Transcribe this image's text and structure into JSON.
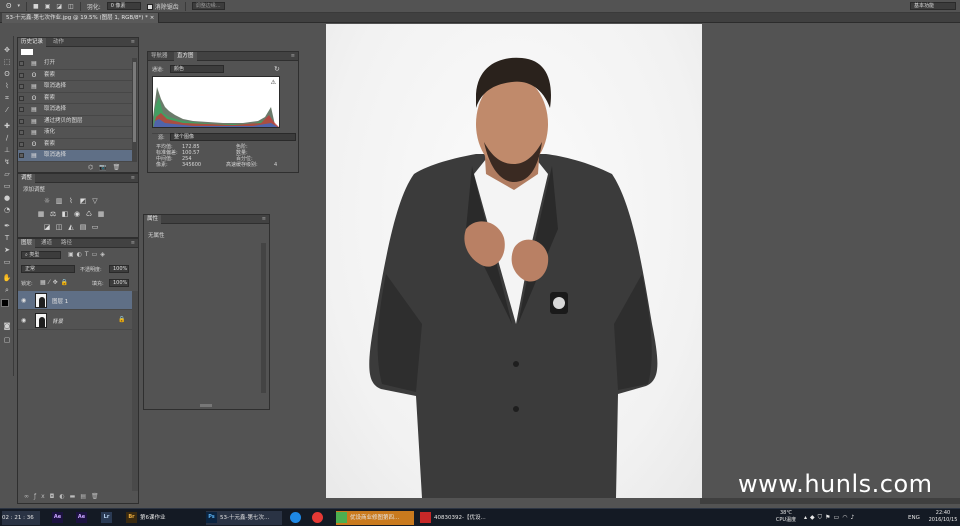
{
  "options_bar": {
    "feather_label": "羽化:",
    "feather_value": "0 像素",
    "antialias_label": "消除锯齿",
    "refine_edge": "调整边缘...",
    "workspace": "基本功能"
  },
  "document_tab": "53-十元鑫-第七次作业.jpg @ 19.5% (图层 1, RGB/8*) *",
  "history_panel": {
    "tabs": [
      "历史记录",
      "动作"
    ],
    "items": [
      {
        "icon": "document-icon",
        "label": "打开"
      },
      {
        "icon": "lasso-icon",
        "label": "套索"
      },
      {
        "icon": "document-icon",
        "label": "取消选择"
      },
      {
        "icon": "lasso-icon",
        "label": "套索"
      },
      {
        "icon": "document-icon",
        "label": "取消选择"
      },
      {
        "icon": "document-icon",
        "label": "通过拷贝的图层"
      },
      {
        "icon": "document-icon",
        "label": "液化"
      },
      {
        "icon": "lasso-icon",
        "label": "套索"
      },
      {
        "icon": "document-icon",
        "label": "取消选择"
      }
    ]
  },
  "adjustments_panel": {
    "tab": "调整",
    "title": "添加调整"
  },
  "layers_panel": {
    "tabs": [
      "图层",
      "通道",
      "路径"
    ],
    "filter": "类型",
    "blend_mode": "正常",
    "opacity_label": "不透明度:",
    "opacity_value": "100%",
    "lock_label": "锁定:",
    "fill_label": "填充:",
    "fill_value": "100%",
    "layers": [
      {
        "name": "图层 1",
        "selected": true
      },
      {
        "name": "背景",
        "selected": false,
        "locked": true
      }
    ]
  },
  "histogram_panel": {
    "tabs": [
      "导航器",
      "直方图"
    ],
    "channel_label": "通道:",
    "channel_value": "颜色",
    "source_label": "源:",
    "source_value": "整个图像",
    "stats": {
      "mean_label": "平均值:",
      "mean": "172.85",
      "stddev_label": "标准偏差:",
      "stddev": "100.57",
      "median_label": "中间值:",
      "median": "254",
      "pixels_label": "像素:",
      "pixels": "345600",
      "level_label": "色阶:",
      "count_label": "数量:",
      "percentile_label": "百分位:",
      "cache_label": "高速缓存级别:",
      "cache": "4"
    }
  },
  "properties_panel": {
    "tab": "属性",
    "content": "无属性"
  },
  "taskbar": {
    "time_left": "02 : 21 : 36",
    "items": [
      {
        "badge": "Ae"
      },
      {
        "badge": "Lr"
      },
      {
        "badge": "Br",
        "label": "第6课作业"
      },
      {
        "badge": "Ps",
        "label": "53-十元鑫-第七次..."
      },
      {
        "badge": "",
        "label": "优设商业修图第四..."
      },
      {
        "badge": "",
        "label": "40830392-【优设..."
      }
    ],
    "temp": "38℃",
    "temp_label": "CPU温度",
    "lang": "ENG",
    "clock_time": "22:40",
    "clock_date": "2016/10/15"
  },
  "watermark": "www.hunls.com",
  "colors": {
    "ui_bg": "#535353",
    "panel_header": "#424242",
    "selection": "#5f6f86",
    "taskbar": "#141a24"
  }
}
